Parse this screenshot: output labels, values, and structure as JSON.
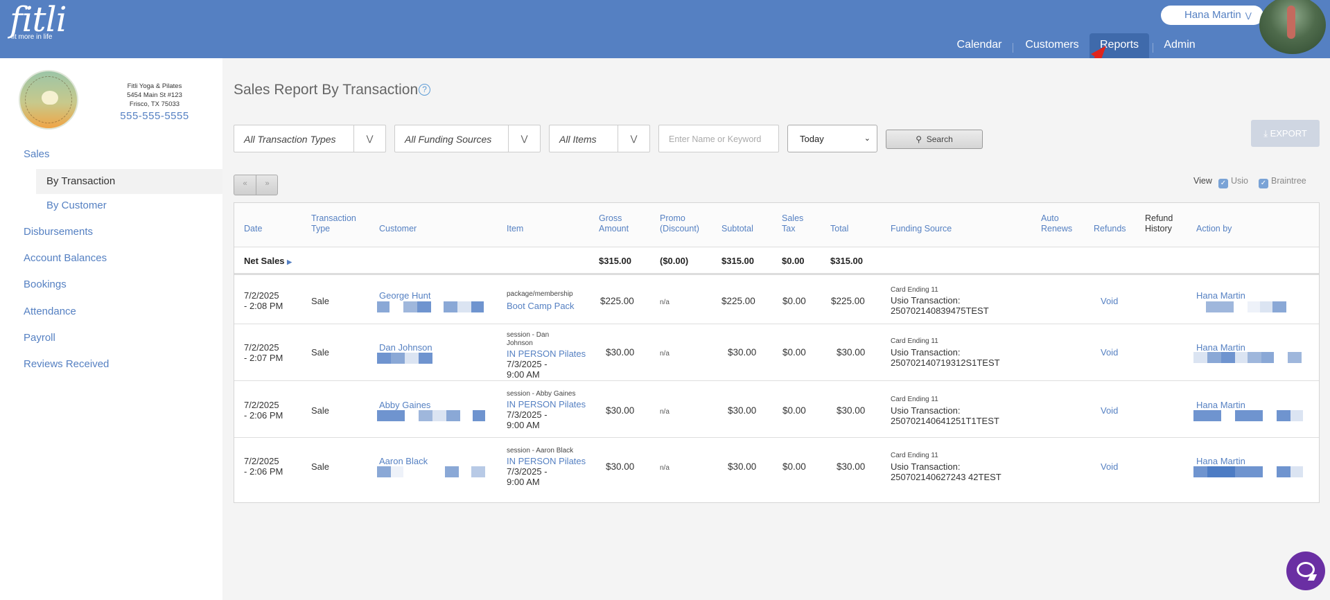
{
  "header": {
    "logo_text": "fitli",
    "logo_tagline": "fit more in life",
    "user_name": "Hana Martin",
    "nav": [
      {
        "label": "Calendar",
        "active": false
      },
      {
        "label": "Customers",
        "active": false
      },
      {
        "label": "Reports",
        "active": true
      },
      {
        "label": "Admin",
        "active": false
      }
    ],
    "colors": {
      "header_bg": "#5580c2",
      "active_tab": "#3f6aab",
      "annotation_arrow": "#e0241b"
    }
  },
  "studio": {
    "name": "Fitli Yoga & Pilates",
    "address1": "5454 Main St #123",
    "address2": "Frisco, TX 75033",
    "phone": "555-555-5555"
  },
  "sidebar": {
    "items": [
      {
        "label": "Sales"
      },
      {
        "label": "By Transaction",
        "active": true
      },
      {
        "label": "By Customer"
      },
      {
        "label": "Disbursements"
      },
      {
        "label": "Account Balances"
      },
      {
        "label": "Bookings"
      },
      {
        "label": "Attendance"
      },
      {
        "label": "Payroll"
      },
      {
        "label": "Reviews Received"
      }
    ]
  },
  "report": {
    "title": "Sales Report By Transaction",
    "help_icon": "question-circle-icon",
    "filters": {
      "transaction_types": "All Transaction Types",
      "funding_sources": "All Funding Sources",
      "items": "All Items",
      "keyword_placeholder": "Enter Name or Keyword",
      "date_range": "Today",
      "search_label": "Search"
    },
    "export_label": "EXPORT",
    "pager": {
      "prev": "«",
      "next": "»"
    },
    "view": {
      "label": "View",
      "usio": "Usio",
      "braintree": "Braintree",
      "usio_checked": true,
      "braintree_checked": true
    },
    "columns": {
      "date": "Date",
      "transaction_type_1": "Transaction",
      "transaction_type_2": "Type",
      "customer": "Customer",
      "item": "Item",
      "gross_1": "Gross",
      "gross_2": "Amount",
      "promo_1": "Promo",
      "promo_2": "(Discount)",
      "subtotal": "Subtotal",
      "tax_1": "Sales",
      "tax_2": "Tax",
      "total": "Total",
      "funding": "Funding Source",
      "auto_1": "Auto",
      "auto_2": "Renews",
      "refunds": "Refunds",
      "refund_history_1": "Refund",
      "refund_history_2": "History",
      "action_by": "Action by"
    },
    "net_sales": {
      "label": "Net Sales",
      "gross": "$315.00",
      "promo": "($0.00)",
      "subtotal": "$315.00",
      "tax": "$0.00",
      "total": "$315.00"
    },
    "rows": [
      {
        "date1": "7/2/2025",
        "date2": "- 2:08 PM",
        "type": "Sale",
        "customer": "George Hunt",
        "item_sub": "package/membership",
        "item_sub2": "",
        "item_name": "Boot Camp Pack",
        "item_date1": "",
        "item_date2": "",
        "gross": "$225.00",
        "promo": "n/a",
        "subtotal": "$225.00",
        "tax": "$0.00",
        "total": "$225.00",
        "card": "Card Ending 11",
        "usio": "Usio Transaction:",
        "txn": "250702140839475TEST",
        "refund": "Void",
        "action_by": "Hana Martin"
      },
      {
        "date1": "7/2/2025",
        "date2": "- 2:07 PM",
        "type": "Sale",
        "customer": "Dan Johnson",
        "item_sub": "session - Dan",
        "item_sub2": "Johnson",
        "item_name": "IN PERSON Pilates",
        "item_date1": "7/3/2025 -",
        "item_date2": "9:00 AM",
        "gross": "$30.00",
        "promo": "n/a",
        "subtotal": "$30.00",
        "tax": "$0.00",
        "total": "$30.00",
        "card": "Card Ending 11",
        "usio": "Usio Transaction:",
        "txn": "250702140719312S1TEST",
        "refund": "Void",
        "action_by": "Hana Martin"
      },
      {
        "date1": "7/2/2025",
        "date2": "- 2:06 PM",
        "type": "Sale",
        "customer": "Abby Gaines",
        "item_sub": "session - Abby Gaines",
        "item_sub2": "",
        "item_name": "IN PERSON Pilates",
        "item_date1": "7/3/2025 -",
        "item_date2": "9:00 AM",
        "gross": "$30.00",
        "promo": "n/a",
        "subtotal": "$30.00",
        "tax": "$0.00",
        "total": "$30.00",
        "card": "Card Ending 11",
        "usio": "Usio Transaction:",
        "txn": "250702140641251T1TEST",
        "refund": "Void",
        "action_by": "Hana Martin"
      },
      {
        "date1": "7/2/2025",
        "date2": "- 2:06 PM",
        "type": "Sale",
        "customer": "Aaron Black",
        "item_sub": "session - Aaron Black",
        "item_sub2": "",
        "item_name": "IN PERSON Pilates",
        "item_date1": "7/3/2025 -",
        "item_date2": "9:00 AM",
        "gross": "$30.00",
        "promo": "n/a",
        "subtotal": "$30.00",
        "tax": "$0.00",
        "total": "$30.00",
        "card": "Card Ending 11",
        "usio": "Usio Transaction:",
        "txn": "250702140627243 42TEST",
        "refund": "Void",
        "action_by": "Hana Martin"
      }
    ]
  },
  "chat": {
    "icon": "chat-bubble-icon",
    "color": "#6a2fa3"
  }
}
